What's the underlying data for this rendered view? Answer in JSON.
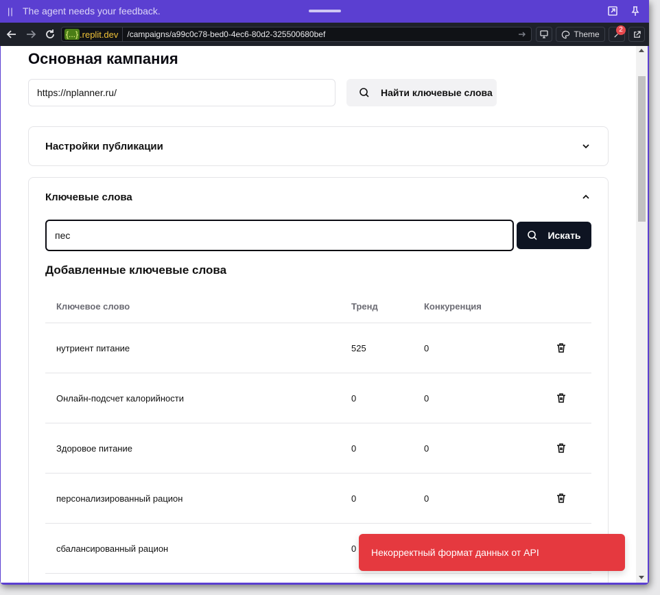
{
  "agent_bar": {
    "message": "The agent needs your feedback.",
    "pause_glyph": "||",
    "icons": [
      "pause-icon",
      "drag-handle",
      "expand-icon",
      "pin-icon"
    ]
  },
  "browser": {
    "url_tag": "{...}",
    "url_domain": ".replit.dev",
    "url_path": "/campaigns/a99c0c78-bed0-4ec6-80d2-325500680bef",
    "theme_label": "Theme",
    "devtools_badge": "2"
  },
  "page": {
    "title": "Основная кампания",
    "site_url_value": "https://nplanner.ru/",
    "find_keywords_label": "Найти ключевые слова"
  },
  "publication_settings": {
    "title": "Настройки публикации"
  },
  "keywords": {
    "title": "Ключевые слова",
    "search_value": "пес",
    "search_button_label": "Искать",
    "added_title": "Добавленные ключевые слова",
    "columns": [
      "Ключевое слово",
      "Тренд",
      "Конкуренция"
    ],
    "rows": [
      {
        "keyword": "нутриент питание",
        "trend": "525",
        "competition": "0"
      },
      {
        "keyword": "Онлайн-подсчет калорийности",
        "trend": "0",
        "competition": "0"
      },
      {
        "keyword": "Здоровое питание",
        "trend": "0",
        "competition": "0"
      },
      {
        "keyword": "персонализированный рацион",
        "trend": "0",
        "competition": "0"
      },
      {
        "keyword": "сбалансированный рацион",
        "trend": "0",
        "competition": ""
      }
    ]
  },
  "toast": {
    "message": "Некорректный формат данных от API"
  },
  "colors": {
    "agent_bar": "#5b3fd1",
    "primary_button": "#0e1422",
    "toast_error": "#e5393f"
  }
}
